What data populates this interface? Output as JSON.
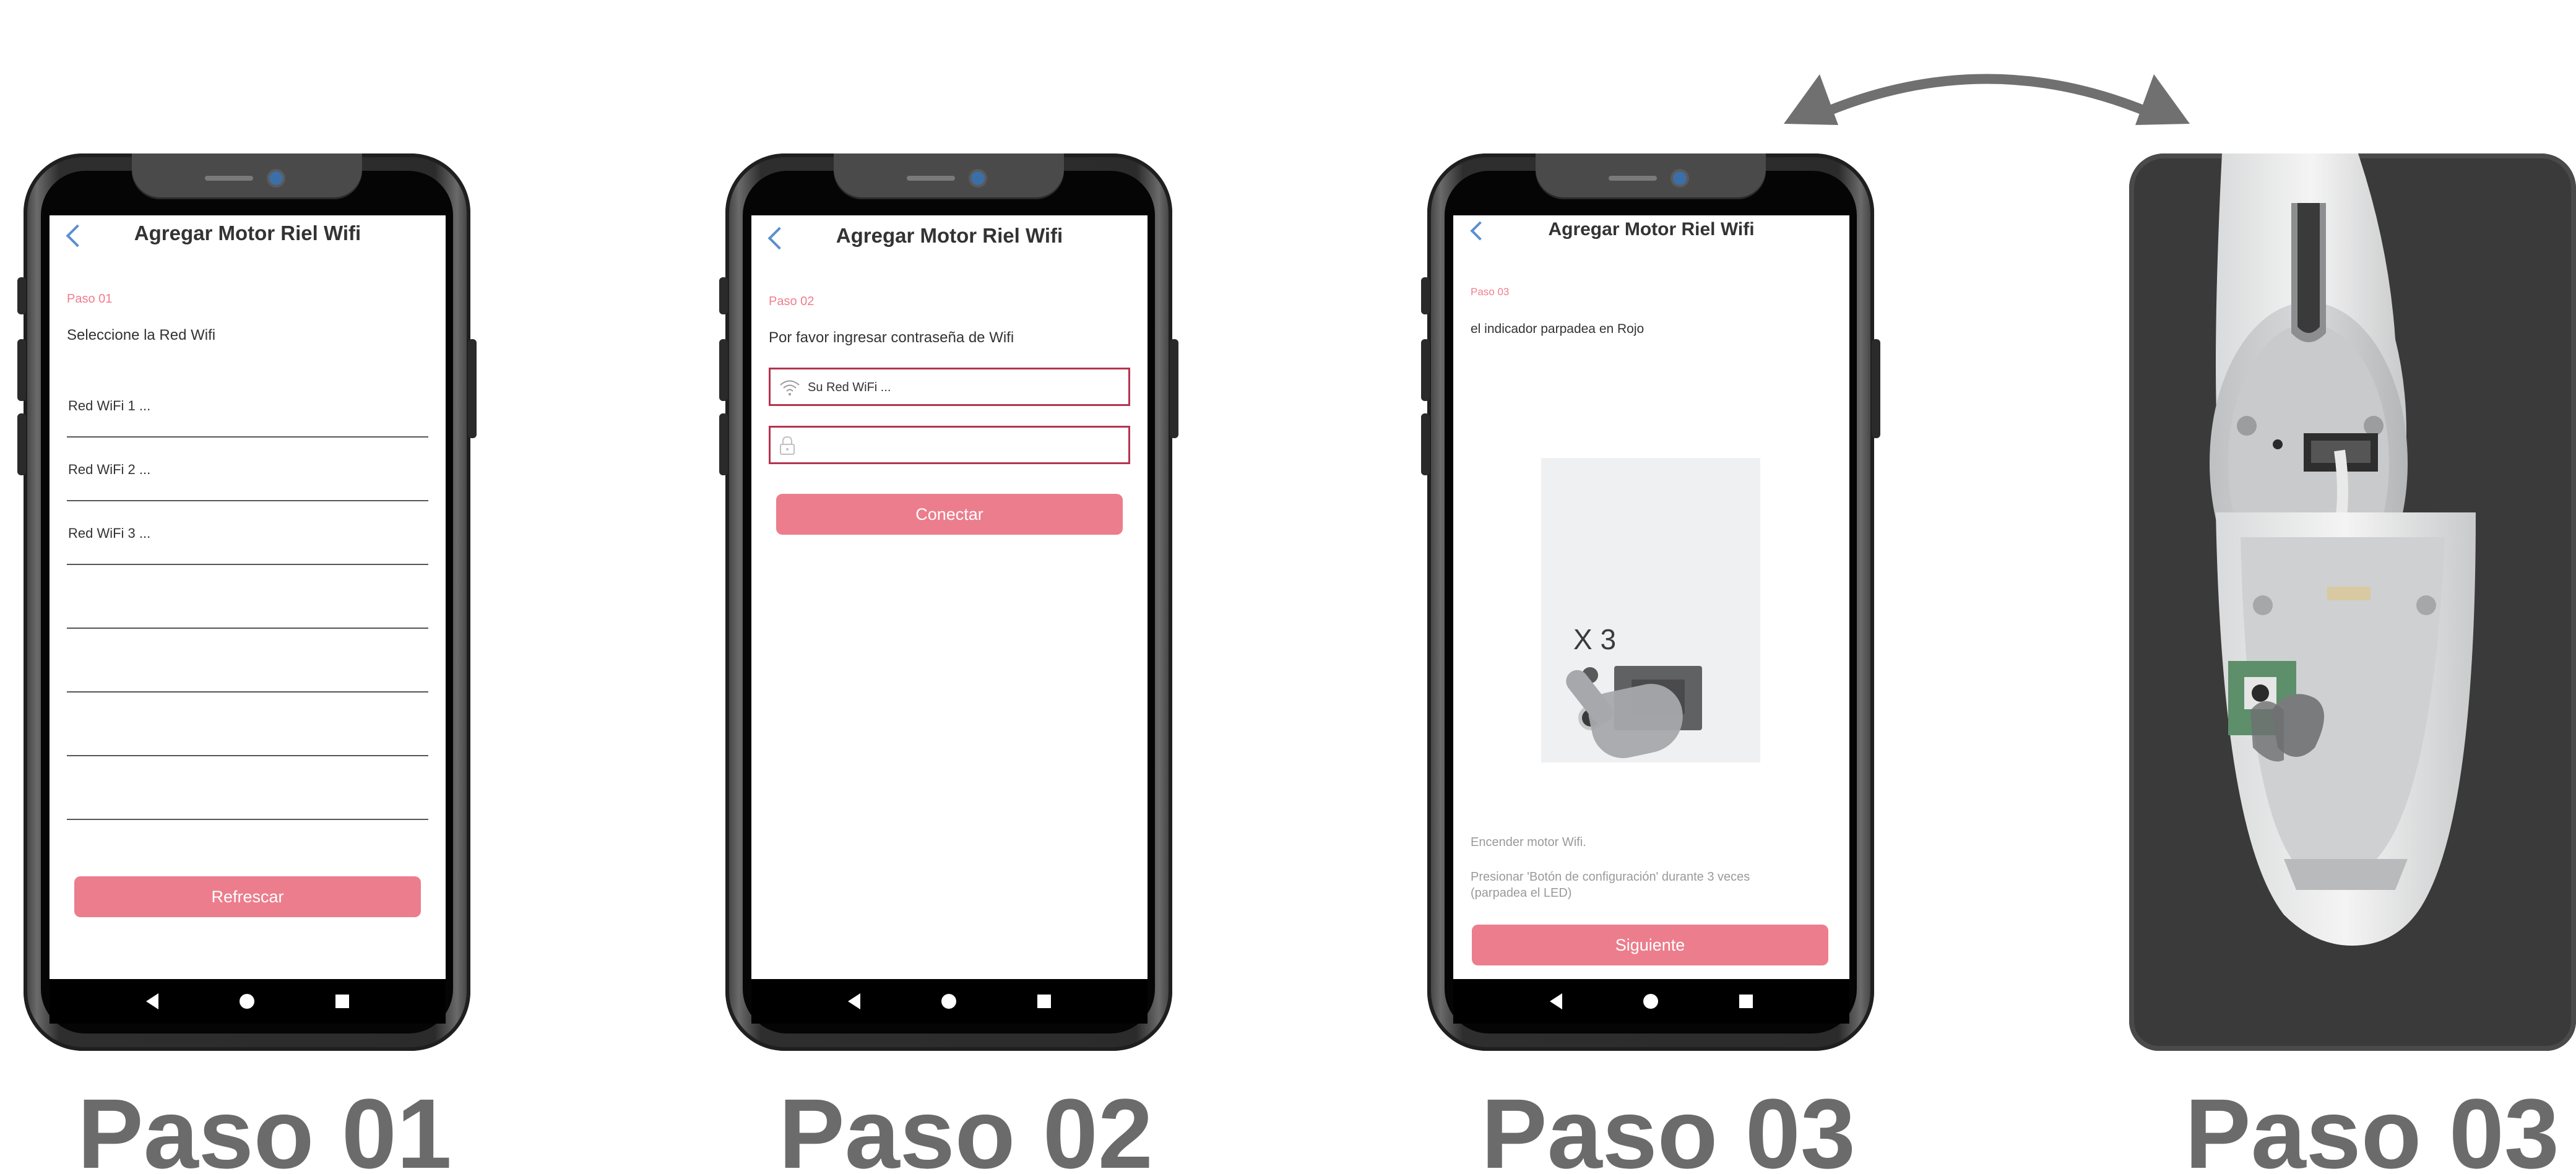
{
  "colors": {
    "accent_pink": "#ec7d8d",
    "step_label_pink": "#ef7e8e",
    "input_border": "#b4344f",
    "back_arrow_blue": "#5b8fd0",
    "caption_gray": "#6b6b6b"
  },
  "phone1": {
    "title": "Agregar Motor Riel Wifi",
    "step": "Paso 01",
    "instruction": "Seleccione la Red Wifi",
    "wifi_items": [
      {
        "label": "Red WiFi 1 ..."
      },
      {
        "label": "Red WiFi 2 ..."
      },
      {
        "label": "Red WiFi 3 ..."
      },
      {
        "label": ""
      },
      {
        "label": ""
      },
      {
        "label": ""
      },
      {
        "label": ""
      }
    ],
    "refresh_label": "Refrescar"
  },
  "phone2": {
    "title": "Agregar Motor Riel Wifi",
    "step": "Paso 02",
    "instruction": "Por favor ingresar contraseña de Wifi",
    "ssid_value": "Su Red WiFi ...",
    "password_value": "",
    "connect_label": "Conectar"
  },
  "phone3": {
    "title": "Agregar Motor Riel Wifi",
    "step": "Paso 03",
    "instruction": "el indicador parpadea en Rojo",
    "illustration_text": "X 3",
    "note1": "Encender motor Wifi.",
    "note2": "Presionar 'Botón de configuración' durante 3 veces (parpadea el LED)",
    "next_label": "Siguiente"
  },
  "icons": {
    "back": "chevron-left-icon",
    "wifi": "wifi-icon",
    "lock": "lock-icon",
    "nav_back": "triangle-back-icon",
    "nav_home": "circle-home-icon",
    "nav_recent": "square-recent-icon",
    "swap_arrow": "double-headed-arrow-icon"
  },
  "captions": [
    "Paso 01",
    "Paso 02",
    "Paso 03",
    "Paso 03"
  ]
}
